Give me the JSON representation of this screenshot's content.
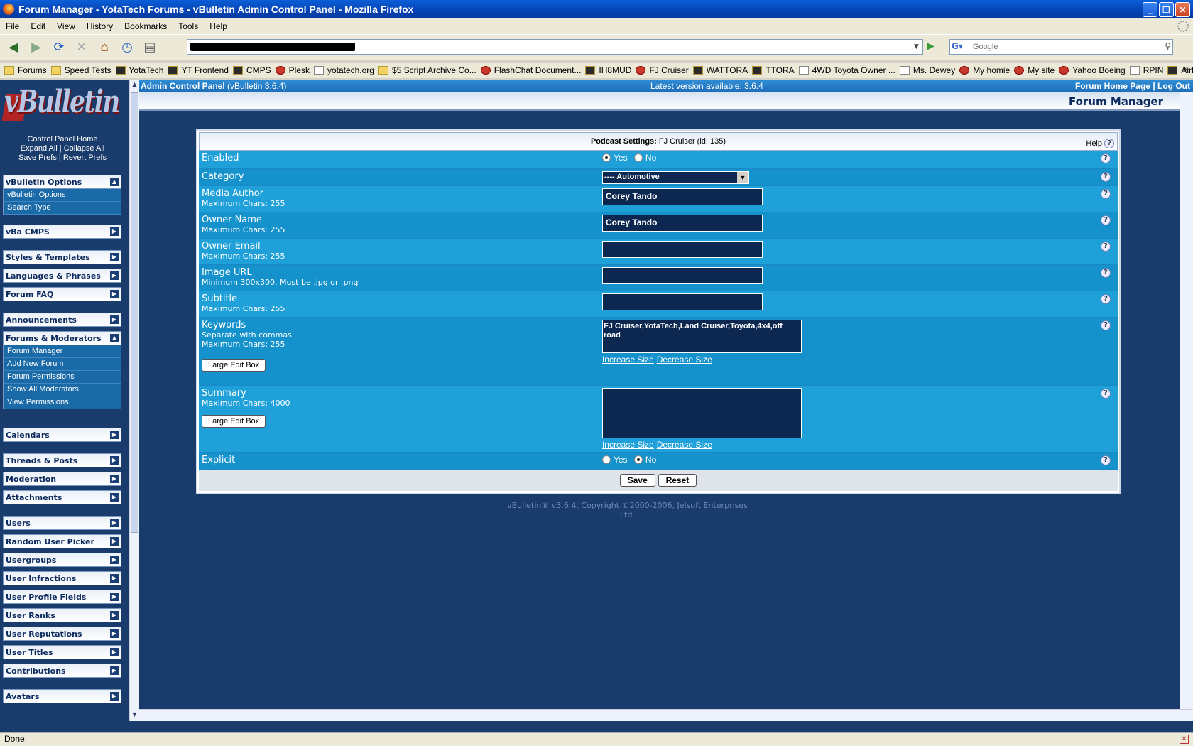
{
  "window": {
    "title": "Forum Manager - YotaTech Forums - vBulletin Admin Control Panel - Mozilla Firefox"
  },
  "menu": [
    "File",
    "Edit",
    "View",
    "History",
    "Bookmarks",
    "Tools",
    "Help"
  ],
  "search": {
    "placeholder": "Google"
  },
  "bookmarks": [
    "Forums",
    "Speed Tests",
    "YotaTech",
    "YT Frontend",
    "CMPS",
    "Plesk",
    "yotatech.org",
    "$5 Script Archive Co...",
    "FlashChat Document...",
    "IH8MUD",
    "FJ Cruiser",
    "WATTORA",
    "TTORA",
    "4WD Toyota Owner ...",
    "Ms. Dewey",
    "My homie",
    "My site",
    "Yahoo Boeing",
    "RPIN",
    "Airliners.net"
  ],
  "sidebar": {
    "links": [
      "Control Panel Home",
      "Expand All",
      "Collapse All",
      "Save Prefs",
      "Revert Prefs"
    ],
    "groups": [
      {
        "title": "vBulletin Options",
        "items": [
          "vBulletin Options",
          "Search Type"
        ]
      },
      {
        "title": "vBa CMPS",
        "items": []
      },
      {
        "title": "Styles & Templates",
        "items": []
      },
      {
        "title": "Languages & Phrases",
        "items": []
      },
      {
        "title": "Forum FAQ",
        "items": []
      },
      {
        "title": "Announcements",
        "items": []
      },
      {
        "title": "Forums & Moderators",
        "items": [
          "Forum Manager",
          "Add New Forum",
          "Forum Permissions",
          "Show All Moderators",
          "View Permissions"
        ]
      },
      {
        "title": "Calendars",
        "items": []
      },
      {
        "title": "Threads & Posts",
        "items": []
      },
      {
        "title": "Moderation",
        "items": []
      },
      {
        "title": "Attachments",
        "items": []
      },
      {
        "title": "Users",
        "items": []
      },
      {
        "title": "Random User Picker",
        "items": []
      },
      {
        "title": "Usergroups",
        "items": []
      },
      {
        "title": "User Infractions",
        "items": []
      },
      {
        "title": "User Profile Fields",
        "items": []
      },
      {
        "title": "User Ranks",
        "items": []
      },
      {
        "title": "User Reputations",
        "items": []
      },
      {
        "title": "User Titles",
        "items": []
      },
      {
        "title": "Contributions",
        "items": []
      },
      {
        "title": "Avatars",
        "items": []
      }
    ]
  },
  "topstrip": {
    "acp": "Admin Control Panel",
    "version": "(vBulletin 3.6.4)",
    "latest": "Latest version available: 3.6.4",
    "home": "Forum Home Page",
    "logout": "Log Out"
  },
  "page_title": "Forum Manager",
  "panel": {
    "heading": "Podcast Settings:",
    "heading_value": "FJ Cruiser (id: 135)",
    "help": "Help",
    "enabled": {
      "label": "Enabled",
      "yes": "Yes",
      "no": "No",
      "selected": "Yes"
    },
    "category": {
      "label": "Category",
      "value": "---- Automotive"
    },
    "media_author": {
      "label": "Media Author",
      "sub": "Maximum Chars: 255",
      "value": "Corey Tando"
    },
    "owner_name": {
      "label": "Owner Name",
      "sub": "Maximum Chars: 255",
      "value": "Corey Tando"
    },
    "owner_email": {
      "label": "Owner Email",
      "sub": "Maximum Chars: 255",
      "value": ""
    },
    "image_url": {
      "label": "Image URL",
      "sub": "Minimum 300x300. Must be .jpg or .png",
      "value": ""
    },
    "subtitle": {
      "label": "Subtitle",
      "sub": "Maximum Chars: 255",
      "value": ""
    },
    "keywords": {
      "label": "Keywords",
      "sub1": "Separate with commas",
      "sub2": "Maximum Chars: 255",
      "value": "FJ Cruiser,YotaTech,Land Cruiser,Toyota,4x4,off road",
      "edit_button": "Large Edit Box",
      "increase": "Increase Size",
      "decrease": "Decrease Size"
    },
    "summary": {
      "label": "Summary",
      "sub": "Maximum Chars: 4000",
      "value": "",
      "edit_button": "Large Edit Box",
      "increase": "Increase Size",
      "decrease": "Decrease Size"
    },
    "explicit": {
      "label": "Explicit",
      "yes": "Yes",
      "no": "No",
      "selected": "No"
    },
    "save": "Save",
    "reset": "Reset"
  },
  "copyright": "vBulletin® v3.6.4, Copyright ©2000-2006, Jelsoft Enterprises Ltd.",
  "status": "Done"
}
